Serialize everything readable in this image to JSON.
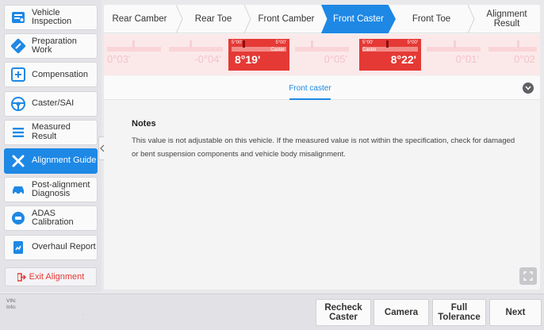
{
  "sidebar": {
    "items": [
      {
        "label": "Vehicle Inspection",
        "icon": "vehicle-inspection-icon"
      },
      {
        "label": "Preparation Work",
        "icon": "wrench-icon"
      },
      {
        "label": "Compensation",
        "icon": "compensation-icon"
      },
      {
        "label": "Caster/SAI",
        "icon": "steering-wheel-icon"
      },
      {
        "label": "Measured Result",
        "icon": "list-icon"
      },
      {
        "label": "Alignment Guide",
        "icon": "tools-icon",
        "active": true
      },
      {
        "label": "Post-alignment Diagnosis",
        "icon": "car-icon"
      },
      {
        "label": "ADAS Calibration",
        "icon": "adas-icon"
      },
      {
        "label": "Overhaul Report",
        "icon": "report-icon"
      }
    ],
    "exit_label": "Exit Alignment"
  },
  "tabs": [
    {
      "label": "Rear Camber"
    },
    {
      "label": "Rear Toe"
    },
    {
      "label": "Front Camber"
    },
    {
      "label": "Front Caster",
      "active": true
    },
    {
      "label": "Front Toe"
    },
    {
      "label": "Alignment Result"
    }
  ],
  "readings": [
    {
      "value": "0°03'",
      "state": "faded"
    },
    {
      "value": "-0°04'",
      "state": "faded"
    },
    {
      "value": "8°19'",
      "state": "hot",
      "left_small": "5°00'",
      "right_small": "5°00'",
      "caption": "Caster"
    },
    {
      "value": "0°05'",
      "state": "faded"
    },
    {
      "value": "8°22'",
      "state": "hot",
      "left_small": "5°00'",
      "right_small": "5°00'",
      "caption": "Caster"
    },
    {
      "value": "0°01'",
      "state": "faded"
    },
    {
      "value": "0°02",
      "state": "faded"
    }
  ],
  "subtab": {
    "label": "Front caster"
  },
  "notes": {
    "title": "Notes",
    "body": "This value is not adjustable on this vehicle. If the measured value is not within the specification, check for damaged or bent suspension components and vehicle body misalignment."
  },
  "bottom": {
    "vin_label": "VIN:",
    "info_label": "Info:",
    "info_value": ".",
    "buttons": {
      "recheck": "Recheck Caster",
      "camera": "Camera",
      "full_tolerance": "Full Tolerance",
      "next": "Next"
    }
  },
  "colors": {
    "accent": "#1e88e5",
    "alert": "#e53935",
    "reading_bg": "#fbe9ea"
  }
}
